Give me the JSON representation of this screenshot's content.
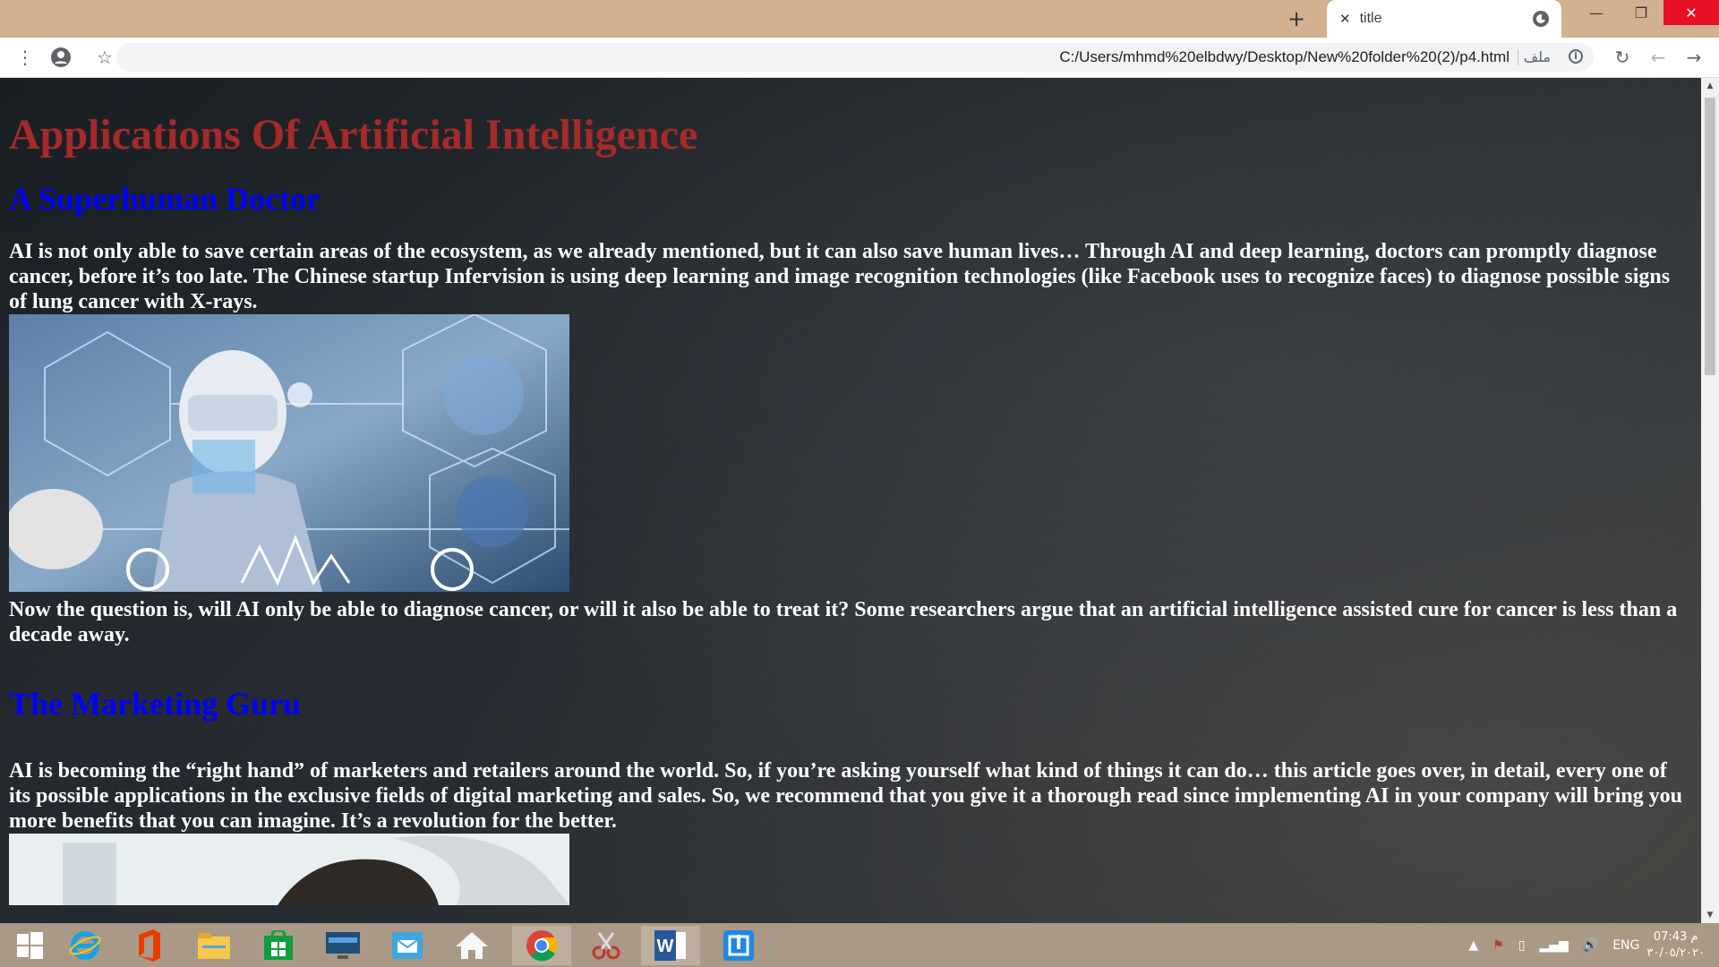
{
  "browser": {
    "tab_title": "title",
    "url": "C:/Users/mhmd%20elbdwy/Desktop/New%20folder%20(2)/p4.html",
    "file_label": "ملف",
    "new_tab_symbol": "+"
  },
  "page": {
    "title": "Applications Of Artificial Intelligence",
    "sections": [
      {
        "heading": "A Superhuman Doctor",
        "para1": "AI is not only able to save certain areas of the ecosystem, as we already mentioned, but it can also save human lives… Through AI and deep learning, doctors can promptly diagnose cancer, before it’s too late. The Chinese startup Infervision is using deep learning and image recognition technologies (like Facebook uses to recognize faces) to diagnose possible signs of lung cancer with X-rays.",
        "para2": "Now the question is, will AI only be able to diagnose cancer, or will it also be able to treat it? Some researchers argue that an artificial intelligence assisted cure for cancer is less than a decade away."
      },
      {
        "heading": "The Marketing Guru",
        "para1": "AI is becoming the “right hand” of marketers and retailers around the world. So, if you’re asking yourself what kind of things it can do… this article goes over, in detail, every one of its possible applications in the exclusive fields of digital marketing and sales. So, we recommend that you give it a thorough read since implementing AI in your company will bring you more benefits that you can imagine. It’s a revolution for the better."
      }
    ]
  },
  "taskbar": {
    "language": "ENG",
    "time": "07:43 م",
    "date": "٣٠/٠٥/٢٠٢٠"
  },
  "colors": {
    "title": "#a52a2a",
    "heading": "#0000ff",
    "body_text": "#ffffff",
    "titlebar": "#d3b08f",
    "taskbar": "#a99986"
  }
}
